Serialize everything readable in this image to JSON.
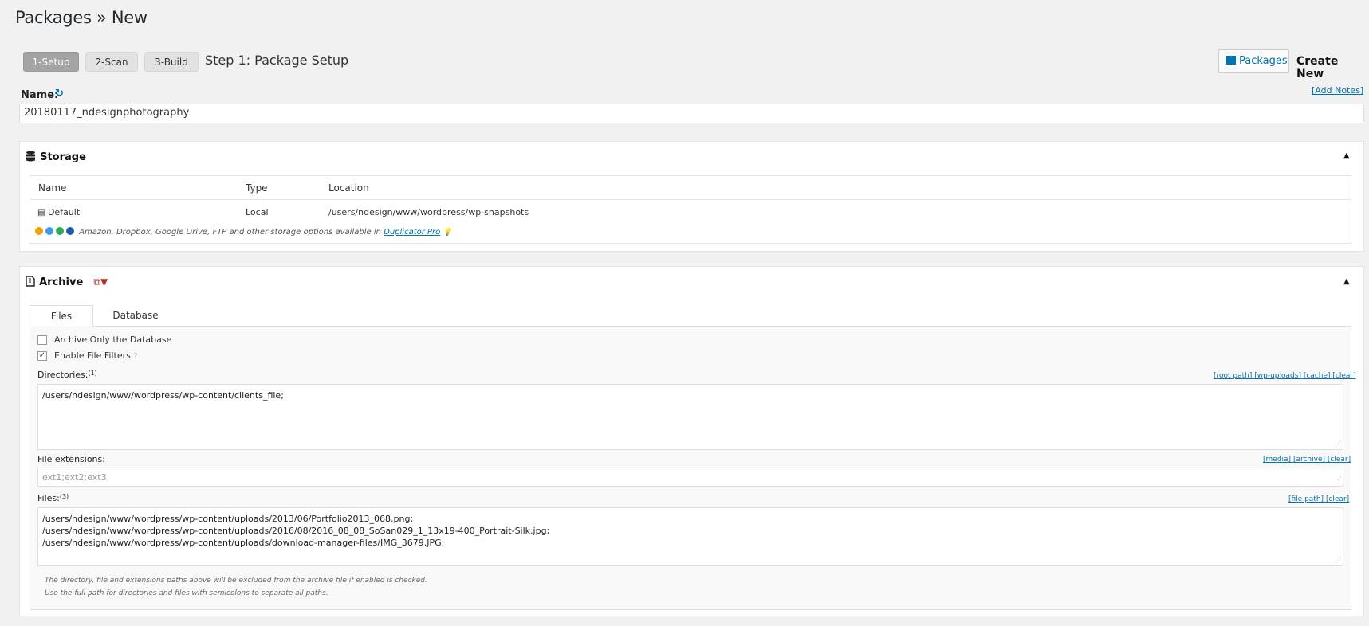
{
  "page": {
    "title": "Packages » New"
  },
  "steps": {
    "s1": "1-Setup",
    "s2": "2-Scan",
    "s3": "3-Build",
    "current_title": "Step 1: Package Setup"
  },
  "top_actions": {
    "packages_label": "Packages",
    "create_new_label": "Create New"
  },
  "name_section": {
    "label": "Name:",
    "value": "20180117_ndesignphotography",
    "add_notes": "[Add Notes]"
  },
  "storage": {
    "title": "Storage",
    "columns": {
      "name": "Name",
      "type": "Type",
      "location": "Location"
    },
    "row": {
      "name": "Default",
      "type": "Local",
      "location": "/users/ndesign/www/wordpress/wp-snapshots"
    },
    "promo_text": "Amazon, Dropbox, Google Drive, FTP and other storage options available in",
    "promo_link": "Duplicator Pro"
  },
  "archive": {
    "title": "Archive",
    "tabs": {
      "files": "Files",
      "database": "Database"
    },
    "archive_only_db": {
      "label": "Archive Only the Database",
      "checked": false
    },
    "enable_filters": {
      "label": "Enable File Filters",
      "checked": true
    },
    "directories": {
      "label": "Directories:",
      "sup": "(1)",
      "links": {
        "root_path": "[root path]",
        "wp_uploads": "[wp-uploads]",
        "cache": "[cache]",
        "clear": "[clear]"
      },
      "value": "/users/ndesign/www/wordpress/wp-content/clients_file;"
    },
    "extensions": {
      "label": "File extensions:",
      "links": {
        "media": "[media]",
        "archive": "[archive]",
        "clear": "[clear]"
      },
      "placeholder": "ext1;ext2;ext3;"
    },
    "files": {
      "label": "Files:",
      "sup": "(3)",
      "links": {
        "file_path": "[file path]",
        "clear": "[clear]"
      },
      "lines": [
        "/users/ndesign/www/wordpress/wp-content/uploads/2013/06/Portfolio2013_068.png;",
        "/users/ndesign/www/wordpress/wp-content/uploads/2016/08/2016_08_08_SoSan029_1_13x19-400_Portrait-Silk.jpg;",
        "/users/ndesign/www/wordpress/wp-content/uploads/download-manager-files/IMG_3679.JPG;"
      ]
    },
    "notes": {
      "line1": "The directory, file and extensions paths above will be excluded from the archive file if enabled is checked.",
      "line2": "Use the full path for directories and files with semicolons to separate all paths."
    }
  }
}
